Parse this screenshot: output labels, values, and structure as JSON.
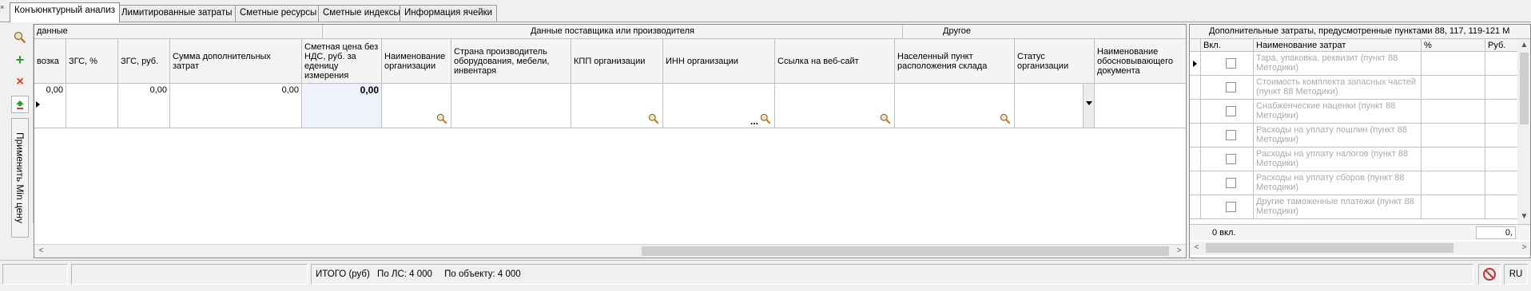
{
  "tabs": [
    {
      "label": "Конъюнктурный анализ"
    },
    {
      "label": "Лимитированные затраты"
    },
    {
      "label": "Сметные ресурсы"
    },
    {
      "label": "Сметные индексы"
    },
    {
      "label": "Информация ячейки"
    }
  ],
  "toolbar": {
    "apply_min_price": "Применить Min цену"
  },
  "grid": {
    "groups": {
      "data": "данные",
      "supplier": "Данные поставщика или производителя",
      "other": "Другое"
    },
    "columns": {
      "transport": "возка",
      "zgs_pct": "ЗГС, %",
      "zgs_rub": "ЗГС, руб.",
      "add_costs": "Сумма дополнительных затрат",
      "price": "Сметная цена без НДС, руб. за еденицу измерения",
      "org_name": "Наименование организации",
      "country": "Страна производитель оборудования, мебели, инвентаря",
      "kpp": "КПП организации",
      "inn": "ИНН организации",
      "website": "Ссылка на веб-сайт",
      "warehouse": "Населенный пункт расположения склада",
      "org_status": "Статус организации",
      "doc_name": "Наименование обосновывающего документа"
    },
    "row": {
      "transport": "0,00",
      "zgs_rub": "0,00",
      "add_costs": "0,00",
      "price": "0,00",
      "inn_dots": "..."
    }
  },
  "right_panel": {
    "title": "Дополнительные затраты, предусмотренные пунктами 88, 117, 119-121 М",
    "columns": {
      "included": "Вкл.",
      "name": "Наименование затрат",
      "percent": "%",
      "rub": "Руб."
    },
    "rows": [
      {
        "name": "Тара, упаковка, реквизит (пункт 88 Методики)",
        "checked": false
      },
      {
        "name": "Стоимость комплекта запасных частей (пункт 88 Методики)",
        "checked": false
      },
      {
        "name": "Снабженческие наценки (пункт 88 Методики)",
        "checked": false
      },
      {
        "name": "Расходы на уплату пошлин (пункт 88 Методики)",
        "checked": false
      },
      {
        "name": "Расходы на уплату налогов (пункт 88 Методики)",
        "checked": false
      },
      {
        "name": "Расходы на уплату сборов (пункт 88 Методики)",
        "checked": false
      },
      {
        "name": "Другие таможенные платежи (пункт 88 Методики)",
        "checked": false
      }
    ],
    "footer": {
      "included_count": "0 вкл.",
      "sum": "0,"
    }
  },
  "status": {
    "total_label": "ИТОГО (руб)",
    "by_ls": "По ЛС: 4 000",
    "by_object": "По объекту: 4 000",
    "lang": "RU"
  },
  "icons": [
    "search-icon",
    "add-icon",
    "delete-icon",
    "move-up-icon",
    "row-indicator-icon",
    "dropdown-icon",
    "disabled-icon"
  ],
  "colors": {
    "accent_green": "#2f9a2f",
    "delete_red": "#d23b2b",
    "selected_cell": "#eef3fb",
    "lens_orange": "#c8761e"
  }
}
